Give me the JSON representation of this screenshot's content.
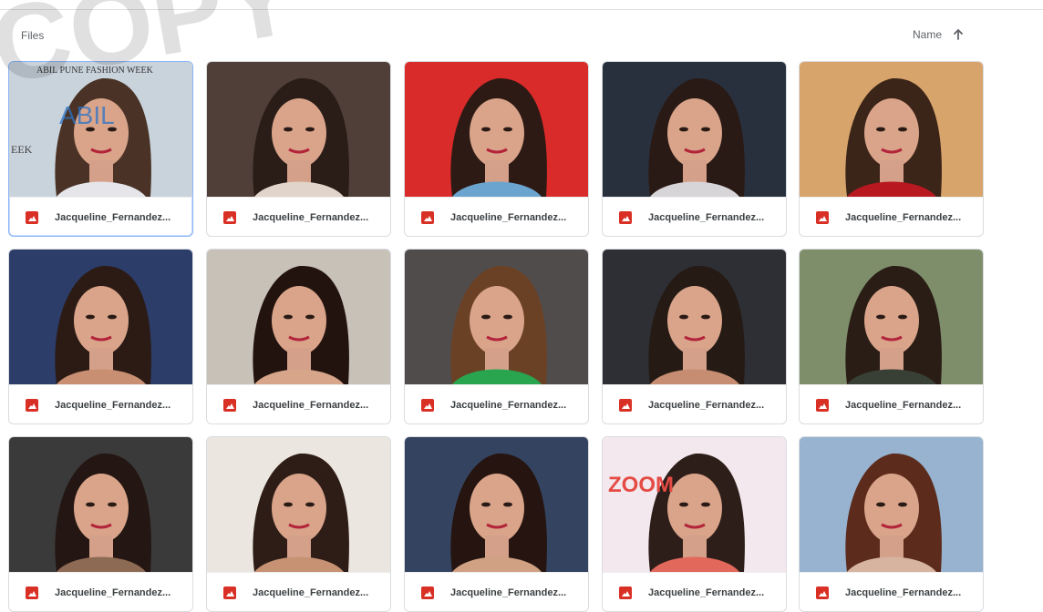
{
  "header": {
    "section_title": "Files",
    "sort_label": "Name",
    "sort_direction_icon": "arrow-up-icon"
  },
  "files": [
    {
      "name": "Jacqueline_Fernandez...",
      "selected": true,
      "bg": "#c9d3dc",
      "hair": "#4a3326",
      "accent": "#e6e6ea"
    },
    {
      "name": "Jacqueline_Fernandez...",
      "selected": false,
      "bg": "#4f3f38",
      "hair": "#2a1c17",
      "accent": "#e1d4ca"
    },
    {
      "name": "Jacqueline_Fernandez...",
      "selected": false,
      "bg": "#d92b2a",
      "hair": "#2d1a14",
      "accent": "#6aa4cf"
    },
    {
      "name": "Jacqueline_Fernandez...",
      "selected": false,
      "bg": "#28303d",
      "hair": "#2a1a15",
      "accent": "#d8d5d8"
    },
    {
      "name": "Jacqueline_Fernandez...",
      "selected": false,
      "bg": "#d7a46b",
      "hair": "#3b2418",
      "accent": "#b81921"
    },
    {
      "name": "Jacqueline_Fernandez...",
      "selected": false,
      "bg": "#2b3d68",
      "hair": "#2c1b15",
      "accent": "#c98f72"
    },
    {
      "name": "Jacqueline_Fernandez...",
      "selected": false,
      "bg": "#c8c1b8",
      "hair": "#22130f",
      "accent": "#d6a58a"
    },
    {
      "name": "Jacqueline_Fernandez...",
      "selected": false,
      "bg": "#514c4c",
      "hair": "#6b4125",
      "accent": "#29a54f"
    },
    {
      "name": "Jacqueline_Fernandez...",
      "selected": false,
      "bg": "#2d2f34",
      "hair": "#251a14",
      "accent": "#c68d72"
    },
    {
      "name": "Jacqueline_Fernandez...",
      "selected": false,
      "bg": "#7e8e6b",
      "hair": "#2a1d16",
      "accent": "#384036"
    },
    {
      "name": "Jacqueline_Fernandez...",
      "selected": false,
      "bg": "#3a3a3a",
      "hair": "#241612",
      "accent": "#8d6a54"
    },
    {
      "name": "Jacqueline_Fernandez...",
      "selected": false,
      "bg": "#ebe6df",
      "hair": "#2e1d17",
      "accent": "#c79274"
    },
    {
      "name": "Jacqueline_Fernandez...",
      "selected": false,
      "bg": "#34435f",
      "hair": "#25140f",
      "accent": "#d0a283"
    },
    {
      "name": "Jacqueline_Fernandez...",
      "selected": false,
      "bg": "#f3e8ee",
      "hair": "#2e1e19",
      "accent": "#e2685c"
    },
    {
      "name": "Jacqueline_Fernandez...",
      "selected": false,
      "bg": "#97b3d0",
      "hair": "#5c2b1c",
      "accent": "#d7b4a0"
    }
  ],
  "thumbnail_text": {
    "card1_line1": "ABIL PUNE FASHION WEEK",
    "card1_line2": "ABIL",
    "card1_line3": "EEK",
    "card13_line1": "ZOOM"
  },
  "watermark_text": "COPY",
  "icons": {
    "file_type_icon": "image-file-icon",
    "sort_icon": "arrow-up-icon"
  }
}
